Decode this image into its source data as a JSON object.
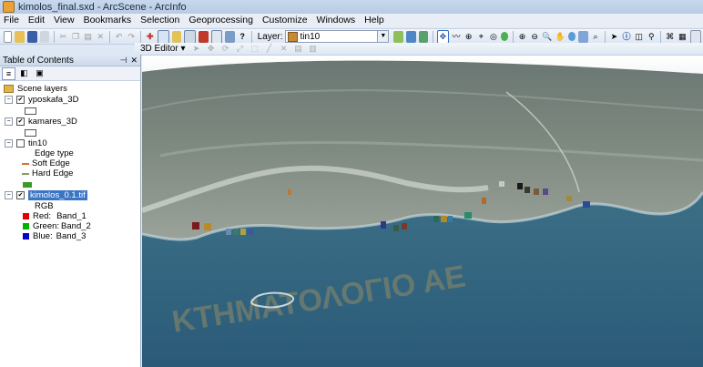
{
  "window": {
    "title": "kimolos_final.sxd - ArcScene - ArcInfo"
  },
  "menu": [
    "File",
    "Edit",
    "View",
    "Bookmarks",
    "Selection",
    "Geoprocessing",
    "Customize",
    "Windows",
    "Help"
  ],
  "toolbar": {
    "layer_label": "Layer:",
    "layer_value": "tin10",
    "editor_label": "3D Editor ▾"
  },
  "toc": {
    "title": "Table of Contents",
    "root": "Scene layers",
    "layers": [
      {
        "name": "yposkafa_3D",
        "checked": true
      },
      {
        "name": "kamares_3D",
        "checked": true
      },
      {
        "name": "tin10",
        "checked": false,
        "legend_heading": "Edge type",
        "legend": [
          "Soft Edge",
          "Hard Edge"
        ]
      },
      {
        "name": "kimolos_0.1.tif",
        "checked": true,
        "legend_heading": "RGB",
        "legend": [
          {
            "label": "Red:",
            "band": "Band_1",
            "color": "#e00000"
          },
          {
            "label": "Green:",
            "band": "Band_2",
            "color": "#00b000"
          },
          {
            "label": "Blue:",
            "band": "Band_3",
            "color": "#0000d0"
          }
        ]
      }
    ]
  },
  "scene": {
    "watermark": "ΚΤΗΜΑΤΟΛΟΓΙΟ ΑΕ"
  },
  "colors": {
    "soft_edge": "#e06a3a",
    "hard_edge": "#8a9a6a",
    "tin_face": "#3a9a2a"
  }
}
